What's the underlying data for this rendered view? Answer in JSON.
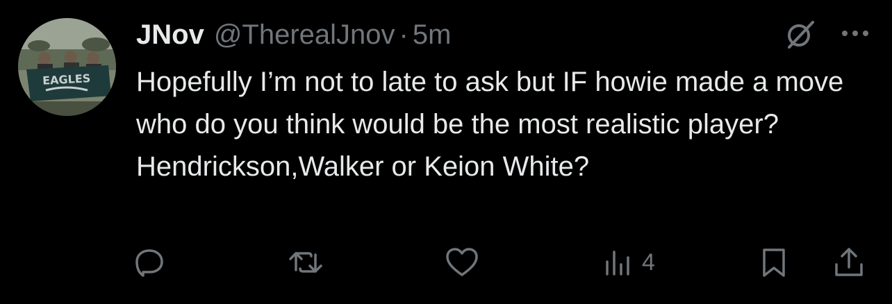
{
  "post": {
    "author_name": "JNov",
    "author_handle": "@TherealJnov",
    "separator": "·",
    "timestamp": "5m",
    "text": "Hopefully I’m not to late to ask but IF howie made a move who do you think would be the most realistic player? Hendrickson,Walker or Keion White?",
    "avatar_banner_text": "EAGLES"
  },
  "actions": {
    "reply_icon": "reply-icon",
    "repost_icon": "repost-icon",
    "like_icon": "heart-icon",
    "views_icon": "views-icon",
    "views_count": "4",
    "bookmark_icon": "bookmark-icon",
    "share_icon": "share-icon"
  },
  "header_icons": {
    "grok": "grok-icon",
    "more": "more-icon"
  },
  "colors": {
    "background": "#000000",
    "primary_text": "#e7e9ea",
    "secondary_text": "#71767b"
  }
}
